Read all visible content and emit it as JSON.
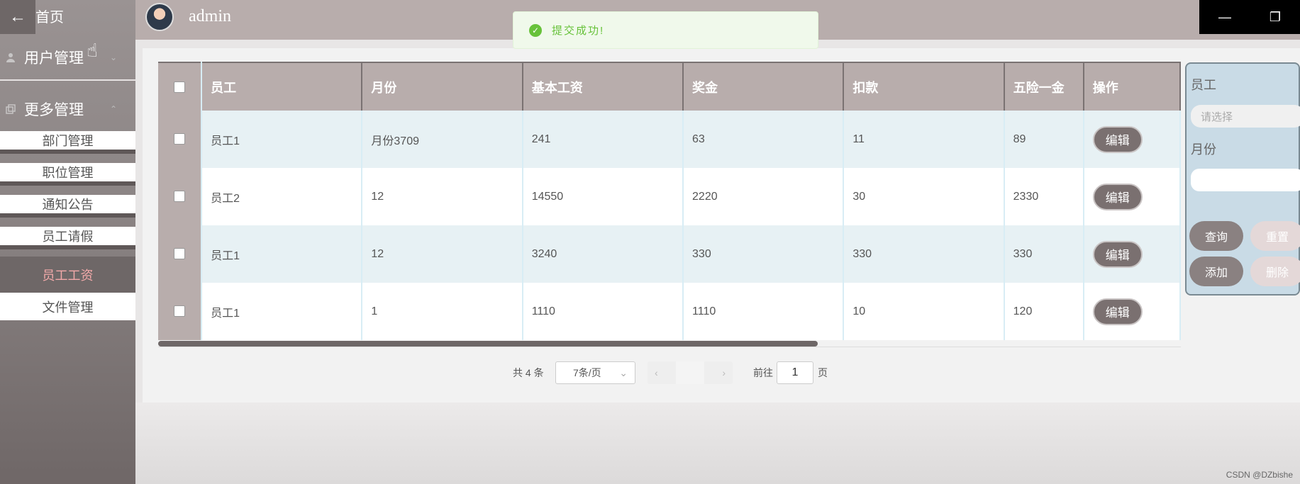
{
  "sidebar": {
    "back_icon": "arrow-left-icon",
    "home_label": "首页",
    "groups": [
      {
        "label": "用户管理",
        "icon": "user-icon"
      },
      {
        "label": "更多管理",
        "icon": "copy-icon"
      }
    ],
    "items": [
      {
        "label": "部门管理"
      },
      {
        "label": "职位管理"
      },
      {
        "label": "通知公告"
      },
      {
        "label": "员工请假"
      },
      {
        "label": "员工工资"
      },
      {
        "label": "文件管理"
      }
    ],
    "active_item": "员工工资"
  },
  "header": {
    "username": "admin"
  },
  "toast": {
    "message": "提交成功!"
  },
  "table": {
    "columns": [
      "员工",
      "月份",
      "基本工资",
      "奖金",
      "扣款",
      "五险一金",
      "操作"
    ],
    "rows": [
      {
        "employee": "员工1",
        "month": "月份3709",
        "base": "241",
        "bonus": "63",
        "deduction": "11",
        "insurance": "89",
        "action": "编辑"
      },
      {
        "employee": "员工2",
        "month": "12",
        "base": "14550",
        "bonus": "2220",
        "deduction": "30",
        "insurance": "2330",
        "action": "编辑"
      },
      {
        "employee": "员工1",
        "month": "12",
        "base": "3240",
        "bonus": "330",
        "deduction": "330",
        "insurance": "330",
        "action": "编辑"
      },
      {
        "employee": "员工1",
        "month": "1",
        "base": "1110",
        "bonus": "1110",
        "deduction": "10",
        "insurance": "120",
        "action": "编辑"
      }
    ]
  },
  "pagination": {
    "total": "共 4 条",
    "page_size": "7条/页",
    "goto_label": "前往",
    "goto_value": "1",
    "page_unit": "页"
  },
  "filter": {
    "employee_label": "员工",
    "employee_placeholder": "请选择",
    "month_label": "月份",
    "query": "查询",
    "reset": "重置",
    "add": "添加",
    "delete": "删除"
  },
  "watermark": "CSDN @DZbishe"
}
